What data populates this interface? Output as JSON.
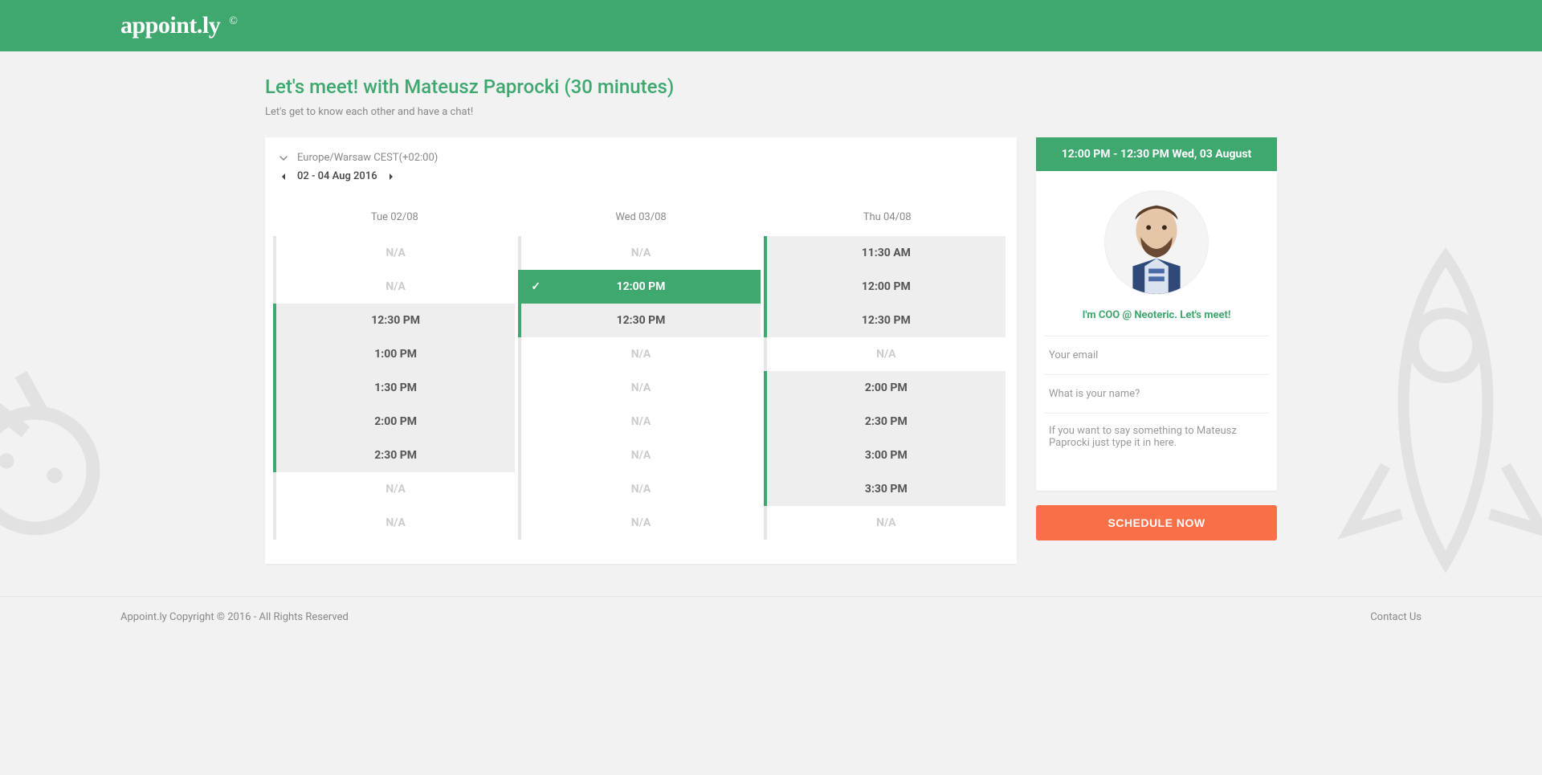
{
  "brand": {
    "name": "appoint.ly",
    "mark": "©"
  },
  "page": {
    "title": "Let's meet! with Mateusz Paprocki (30 minutes)",
    "subtitle": "Let's get to know each other and have a chat!"
  },
  "timezone": {
    "label": "Europe/Warsaw CEST(+02:00)"
  },
  "daterange": {
    "label": "02 - 04 Aug 2016"
  },
  "columns": [
    {
      "header": "Tue 02/08",
      "slots": [
        {
          "label": "N/A",
          "state": "na"
        },
        {
          "label": "N/A",
          "state": "na"
        },
        {
          "label": "12:30 PM",
          "state": "available"
        },
        {
          "label": "1:00 PM",
          "state": "available"
        },
        {
          "label": "1:30 PM",
          "state": "available"
        },
        {
          "label": "2:00 PM",
          "state": "available"
        },
        {
          "label": "2:30 PM",
          "state": "available"
        },
        {
          "label": "N/A",
          "state": "na"
        },
        {
          "label": "N/A",
          "state": "na"
        }
      ]
    },
    {
      "header": "Wed 03/08",
      "slots": [
        {
          "label": "N/A",
          "state": "na"
        },
        {
          "label": "12:00 PM",
          "state": "selected"
        },
        {
          "label": "12:30 PM",
          "state": "available"
        },
        {
          "label": "N/A",
          "state": "na"
        },
        {
          "label": "N/A",
          "state": "na"
        },
        {
          "label": "N/A",
          "state": "na"
        },
        {
          "label": "N/A",
          "state": "na"
        },
        {
          "label": "N/A",
          "state": "na"
        },
        {
          "label": "N/A",
          "state": "na"
        }
      ]
    },
    {
      "header": "Thu 04/08",
      "slots": [
        {
          "label": "11:30 AM",
          "state": "available"
        },
        {
          "label": "12:00 PM",
          "state": "available"
        },
        {
          "label": "12:30 PM",
          "state": "available"
        },
        {
          "label": "N/A",
          "state": "na"
        },
        {
          "label": "2:00 PM",
          "state": "available"
        },
        {
          "label": "2:30 PM",
          "state": "available"
        },
        {
          "label": "3:00 PM",
          "state": "available"
        },
        {
          "label": "3:30 PM",
          "state": "available"
        },
        {
          "label": "N/A",
          "state": "na"
        }
      ]
    }
  ],
  "selection": {
    "banner": "12:00 PM - 12:30 PM Wed, 03 August"
  },
  "host": {
    "bio": "I'm COO @ Neoteric. Let's meet!"
  },
  "form": {
    "email_placeholder": "Your email",
    "name_placeholder": "What is your name?",
    "message_placeholder": "If you want to say something to Mateusz Paprocki just type it in here.",
    "cta": "SCHEDULE NOW"
  },
  "footer": {
    "copyright": "Appoint.ly Copyright © 2016 - All Rights Reserved",
    "contact": "Contact Us"
  },
  "na_text": "N/A"
}
